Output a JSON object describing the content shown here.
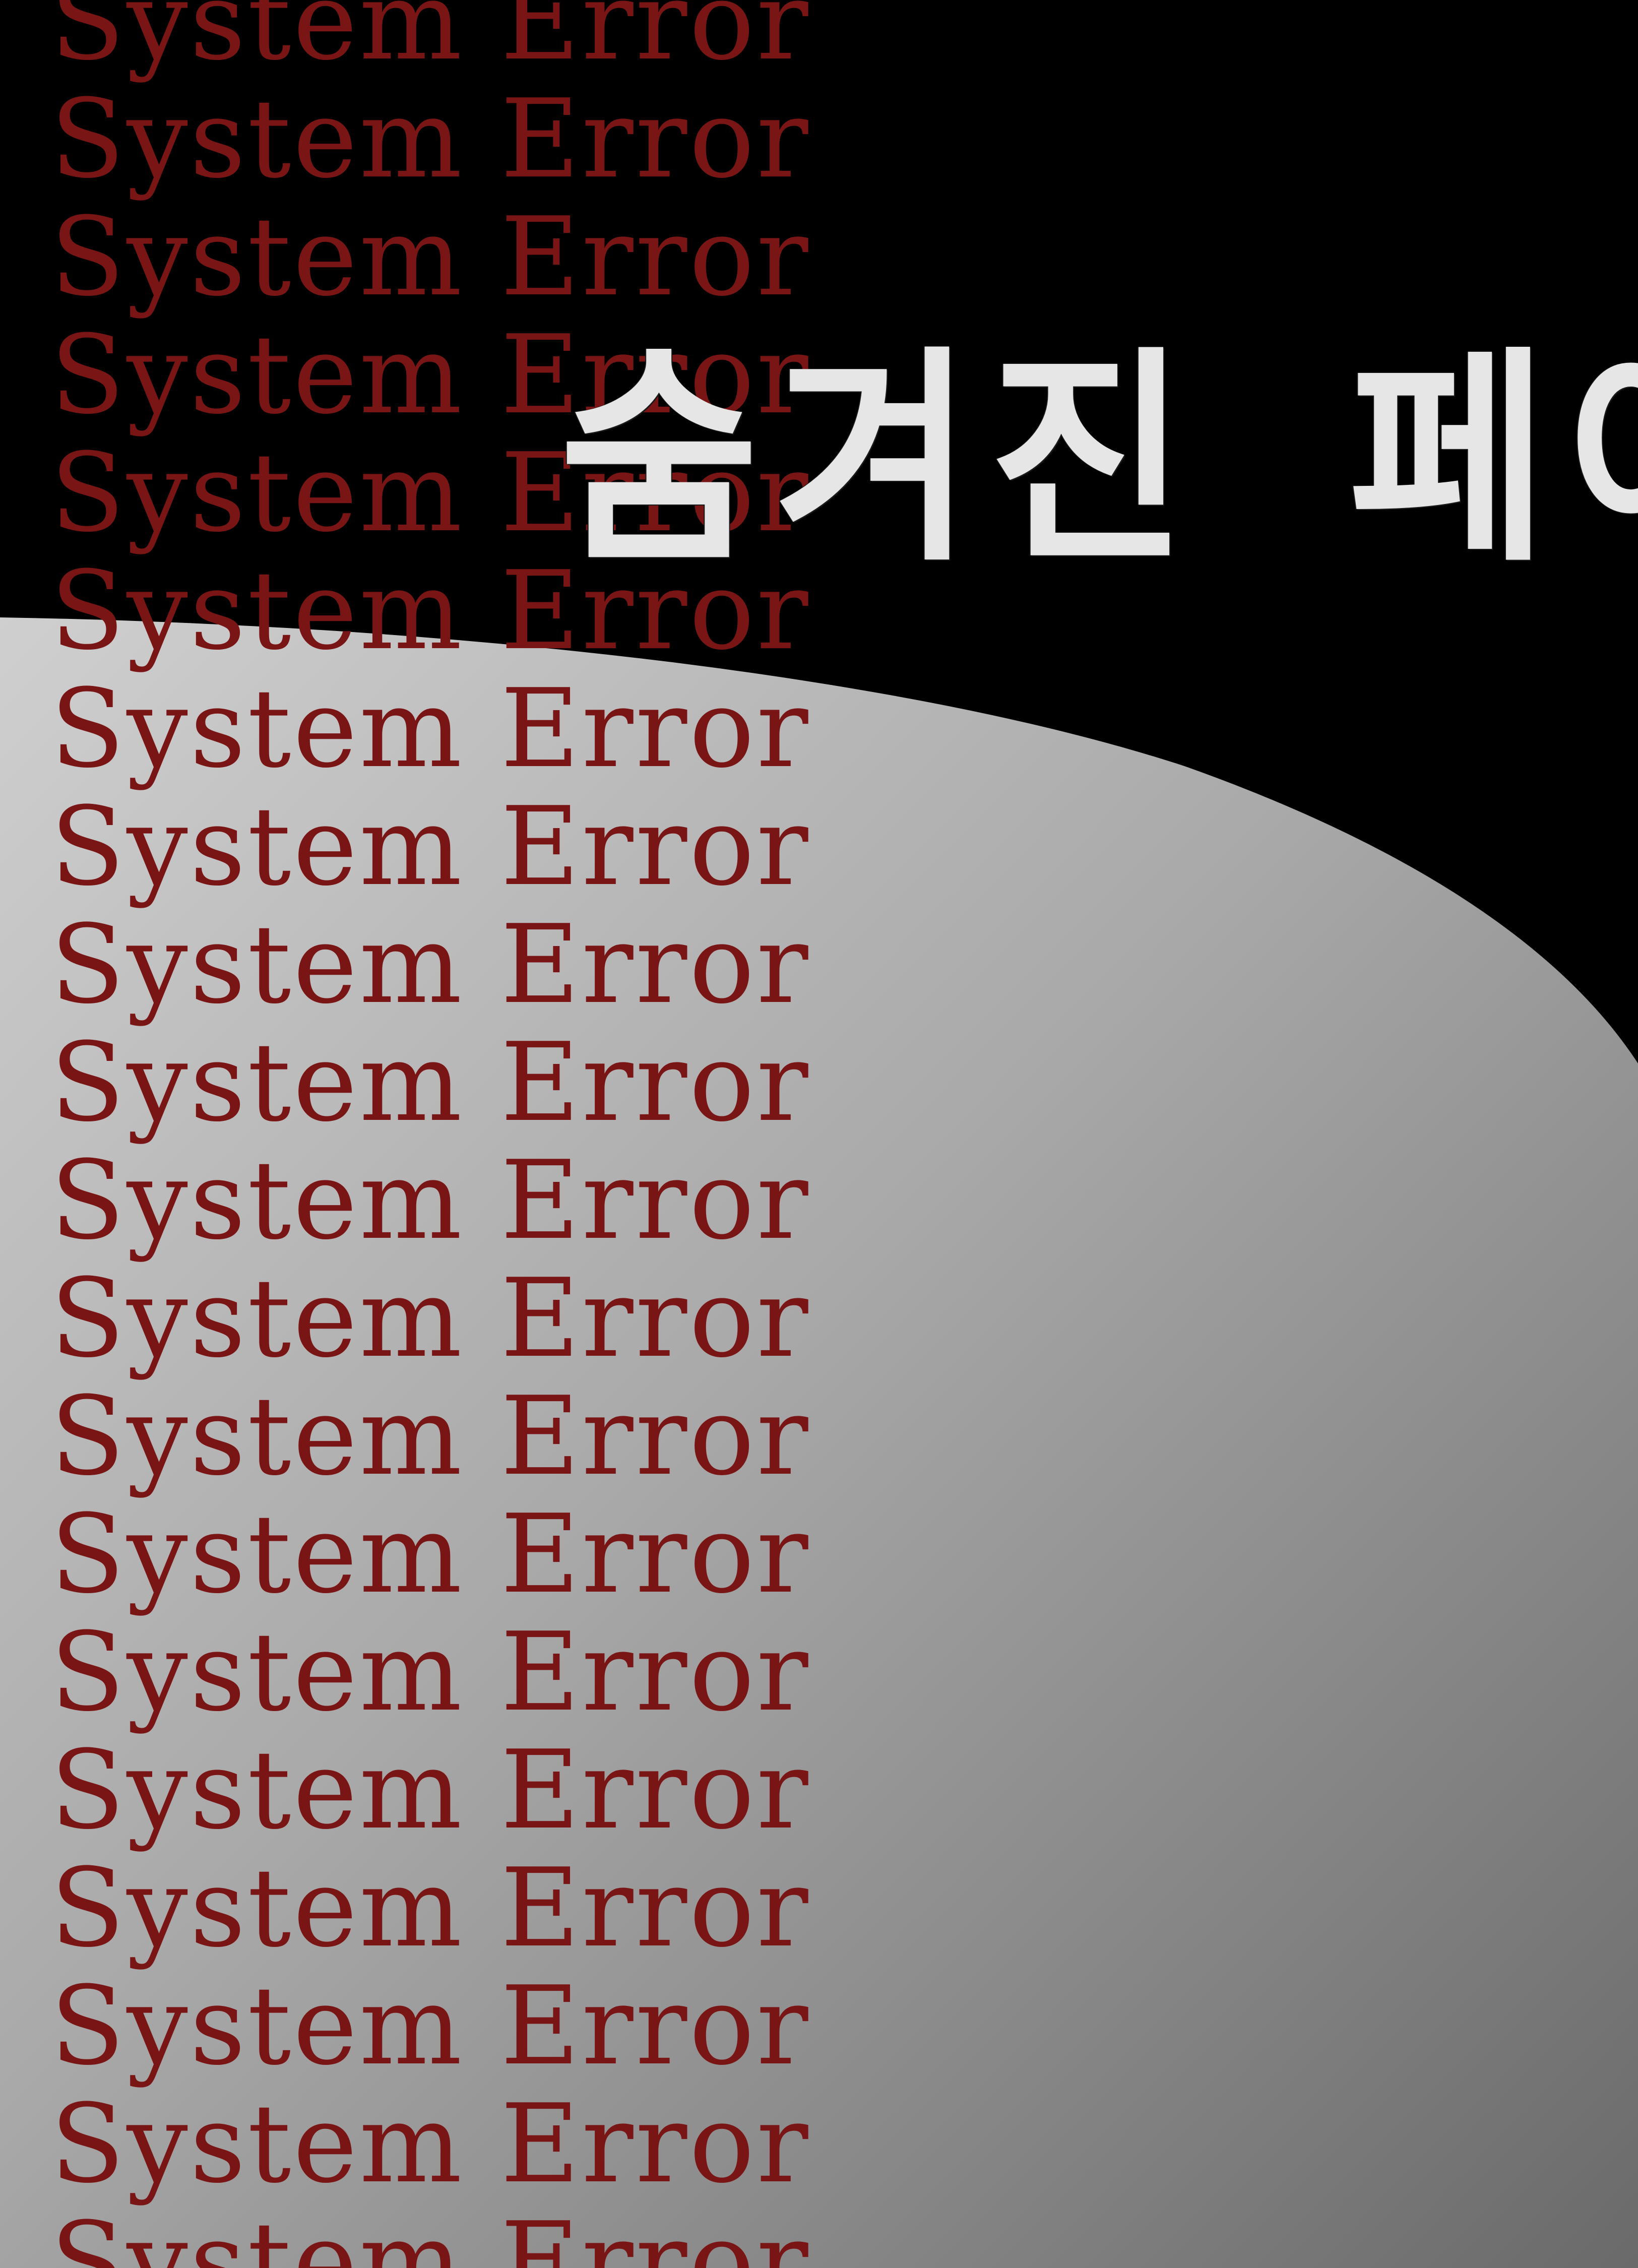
{
  "poster": {
    "title": "숨겨진 페이지",
    "repeated_phrase": "System Error",
    "colors": {
      "background": "#000000",
      "sheet_light": "#c8c8c8",
      "sheet_dark": "#6e6e6e",
      "phrase": "#7a1515",
      "title": "#e6e6e6"
    }
  }
}
